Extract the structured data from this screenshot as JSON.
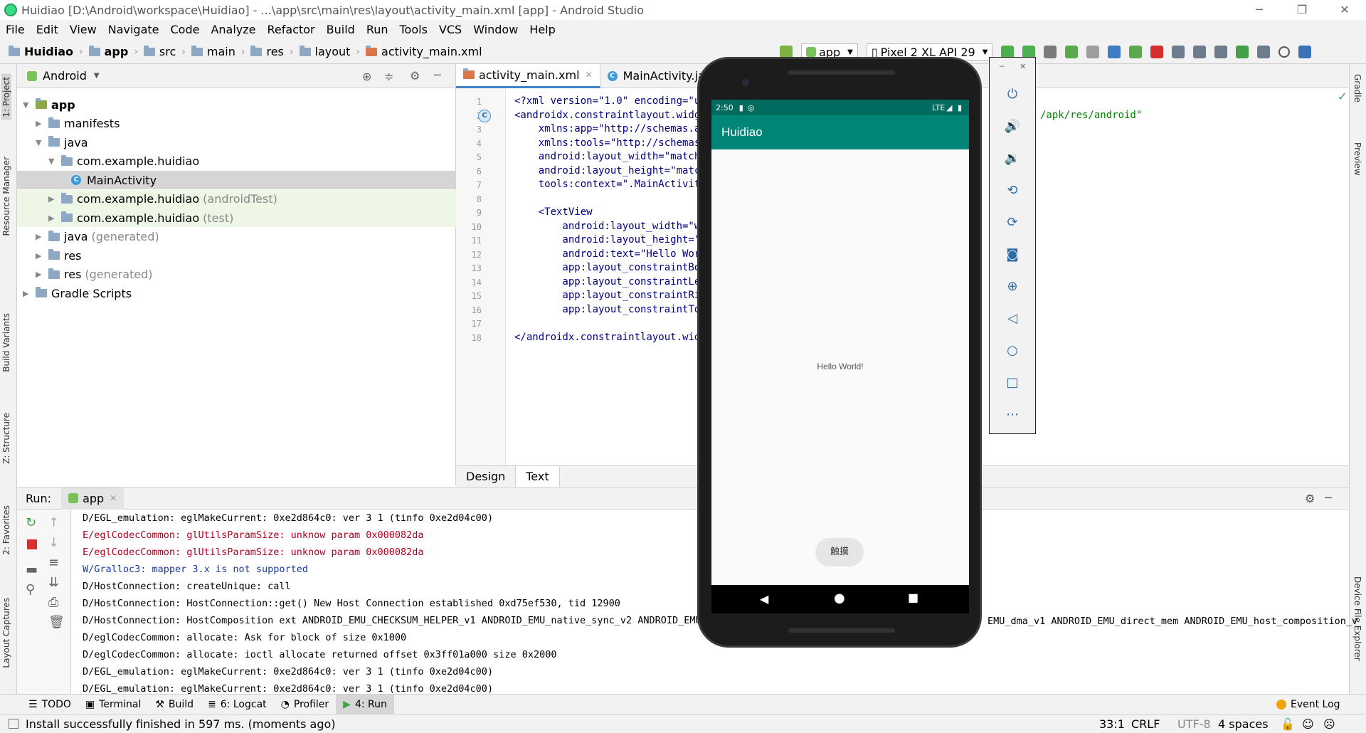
{
  "window": {
    "title": "Huidiao [D:\\Android\\workspace\\Huidiao] - ...\\app\\src\\main\\res\\layout\\activity_main.xml [app] - Android Studio"
  },
  "menu": [
    "File",
    "Edit",
    "View",
    "Navigate",
    "Code",
    "Analyze",
    "Refactor",
    "Build",
    "Run",
    "Tools",
    "VCS",
    "Window",
    "Help"
  ],
  "breadcrumbs": [
    "Huidiao",
    "app",
    "src",
    "main",
    "res",
    "layout",
    "activity_main.xml"
  ],
  "toolbar": {
    "run_config": "app",
    "device": "Pixel 2 XL API 29"
  },
  "left_tabs": [
    "1: Project",
    "Resource Manager",
    "Build Variants",
    "Z: Structure",
    "2: Favorites",
    "Layout Captures"
  ],
  "right_tabs": [
    "Gradle",
    "Preview",
    "Device File Explorer"
  ],
  "project": {
    "view_mode": "Android",
    "tree": [
      {
        "label": "app",
        "suffix": "",
        "depth": 0,
        "expanded": true,
        "bold": true
      },
      {
        "label": "manifests",
        "suffix": "",
        "depth": 1,
        "expanded": false
      },
      {
        "label": "java",
        "suffix": "",
        "depth": 1,
        "expanded": true
      },
      {
        "label": "com.example.huidiao",
        "suffix": "",
        "depth": 2,
        "expanded": true
      },
      {
        "label": "MainActivity",
        "suffix": "",
        "depth": 3,
        "selected": true,
        "class": true
      },
      {
        "label": "com.example.huidiao",
        "suffix": "(androidTest)",
        "depth": 2,
        "expanded": false
      },
      {
        "label": "com.example.huidiao",
        "suffix": "(test)",
        "depth": 2,
        "expanded": false
      },
      {
        "label": "java",
        "suffix": "(generated)",
        "depth": 1,
        "expanded": false
      },
      {
        "label": "res",
        "suffix": "",
        "depth": 1,
        "expanded": false
      },
      {
        "label": "res",
        "suffix": "(generated)",
        "depth": 1,
        "expanded": false
      },
      {
        "label": "Gradle Scripts",
        "suffix": "",
        "depth": 0,
        "expanded": false
      }
    ]
  },
  "editor": {
    "tabs": [
      "activity_main.xml",
      "MainActivity.java"
    ],
    "lines": [
      {
        "n": "1",
        "text": "<?xml version=\"1.0\" encoding=\"ut",
        "tail": ""
      },
      {
        "n": "2",
        "text": "<androidx.constraintlayout.widge",
        "tail": "/apk/res/android\""
      },
      {
        "n": "3",
        "text": "    xmlns:app=\"http://schemas.an",
        "tail": ""
      },
      {
        "n": "4",
        "text": "    xmlns:tools=\"http://schemas.",
        "tail": ""
      },
      {
        "n": "5",
        "text": "    android:layout_width=\"match_",
        "tail": ""
      },
      {
        "n": "6",
        "text": "    android:layout_height=\"match",
        "tail": ""
      },
      {
        "n": "7",
        "text": "    tools:context=\".MainActivity",
        "tail": ""
      },
      {
        "n": "8",
        "text": "",
        "tail": ""
      },
      {
        "n": "9",
        "text": "    <TextView",
        "tail": ""
      },
      {
        "n": "10",
        "text": "        android:layout_width=\"wr",
        "tail": ""
      },
      {
        "n": "11",
        "text": "        android:layout_height=\"w",
        "tail": ""
      },
      {
        "n": "12",
        "text": "        android:text=\"Hello Worl",
        "tail": ""
      },
      {
        "n": "13",
        "text": "        app:layout_constraintBot",
        "tail": ""
      },
      {
        "n": "14",
        "text": "        app:layout_constraintLef",
        "tail": ""
      },
      {
        "n": "15",
        "text": "        app:layout_constraintRig",
        "tail": ""
      },
      {
        "n": "16",
        "text": "        app:layout_constraintTop",
        "tail": ""
      },
      {
        "n": "17",
        "text": "",
        "tail": ""
      },
      {
        "n": "18",
        "text": "</androidx.constraintlayout.widg",
        "tail": ""
      }
    ],
    "mode_tabs": [
      "Design",
      "Text"
    ]
  },
  "run": {
    "label": "Run:",
    "tab": "app",
    "logs": [
      {
        "level": "d",
        "text": "D/EGL_emulation: eglMakeCurrent: 0xe2d864c0: ver 3 1 (tinfo 0xe2d04c00)"
      },
      {
        "level": "e",
        "text": "E/eglCodecCommon: glUtilsParamSize: unknow param 0x000082da"
      },
      {
        "level": "e",
        "text": "E/eglCodecCommon: glUtilsParamSize: unknow param 0x000082da"
      },
      {
        "level": "w",
        "text": "W/Gralloc3: mapper 3.x is not supported"
      },
      {
        "level": "d",
        "text": "D/HostConnection: createUnique: call"
      },
      {
        "level": "d",
        "text": "D/HostConnection: HostConnection::get() New Host Connection established 0xd75ef530, tid 12900"
      },
      {
        "level": "d",
        "text": "D/HostConnection: HostComposition ext ANDROID_EMU_CHECKSUM_HELPER_v1 ANDROID_EMU_native_sync_v2 ANDROID_EMU"
      },
      {
        "level": "d",
        "text": "D/eglCodecCommon: allocate: Ask for block of size 0x1000"
      },
      {
        "level": "d",
        "text": "D/eglCodecCommon: allocate: ioctl allocate returned offset 0x3ff01a000 size 0x2000"
      },
      {
        "level": "d",
        "text": "D/EGL_emulation: eglMakeCurrent: 0xe2d864c0: ver 3 1 (tinfo 0xe2d04c00)"
      },
      {
        "level": "d",
        "text": "D/EGL_emulation: eglMakeCurrent: 0xe2d864c0: ver 3 1 (tinfo 0xe2d04c00)"
      }
    ],
    "log_tail": "EMU_dma_v1 ANDROID_EMU_direct_mem ANDROID_EMU_host_composition_v"
  },
  "bottom_tools": [
    "TODO",
    "Terminal",
    "Build",
    "6: Logcat",
    "Profiler",
    "4: Run"
  ],
  "event_log": "Event Log",
  "status": {
    "message": "Install successfully finished in 597 ms. (moments ago)",
    "position": "33:1",
    "line_sep": "CRLF",
    "encoding": "UTF-8",
    "indent": "4 spaces"
  },
  "phone": {
    "time": "2:50",
    "network": "LTE",
    "app_title": "Huidiao",
    "center_text": "Hello World!",
    "button_label": "触摸"
  },
  "colors": {
    "app_bar": "#008577",
    "status_bar": "#006b5f",
    "accent": "#4083c9"
  }
}
